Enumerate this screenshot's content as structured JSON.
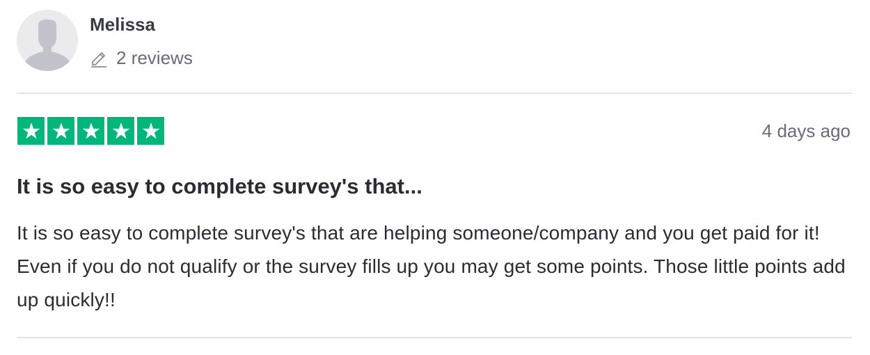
{
  "consumer": {
    "name": "Melissa",
    "reviews_count": "2 reviews",
    "avatar_icon": "default-user-avatar-icon",
    "reviews_icon": "pencil-icon"
  },
  "review": {
    "rating": 5,
    "rating_max": 5,
    "star_color": "#00b67a",
    "date": "4 days ago",
    "title": "It is so easy to complete survey's that...",
    "text": "It is so easy to complete survey's that are helping someone/company and you get paid for it! Even if you do not qualify or the survey fills up you may get some points. Those little points add up quickly!!"
  }
}
